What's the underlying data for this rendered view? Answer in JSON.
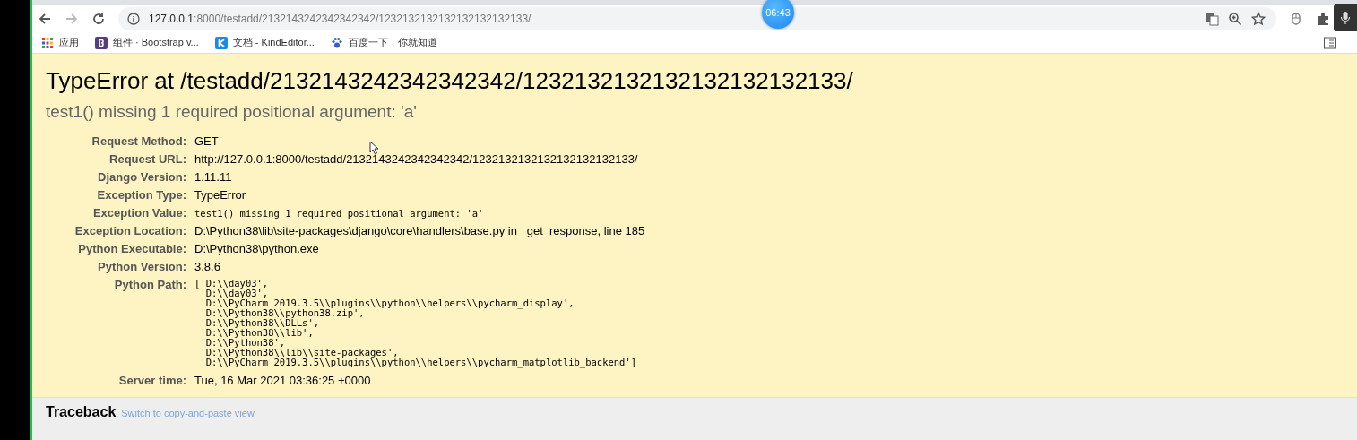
{
  "browser": {
    "url_host": "127.0.0.1",
    "url_rest": ":8000/testadd/2132143242342342342/1232132132132132132132133/",
    "bookmarks": [
      {
        "label": "应用"
      },
      {
        "label": "组件 · Bootstrap v..."
      },
      {
        "label": "文档 - KindEditor..."
      },
      {
        "label": "百度一下，你就知道"
      }
    ],
    "clock": "06:43"
  },
  "error": {
    "title": "TypeError at /testadd/2132143242342342342/1232132132132132132132133/",
    "message": "test1() missing 1 required positional argument: 'a'"
  },
  "meta": [
    {
      "label": "Request Method:",
      "kind": "text",
      "value": "GET"
    },
    {
      "label": "Request URL:",
      "kind": "text",
      "value": "http://127.0.0.1:8000/testadd/2132143242342342342/1232132132132132132132133/"
    },
    {
      "label": "Django Version:",
      "kind": "text",
      "value": "1.11.11"
    },
    {
      "label": "Exception Type:",
      "kind": "text",
      "value": "TypeError"
    },
    {
      "label": "Exception Value:",
      "kind": "code",
      "value": "test1() missing 1 required positional argument: 'a'"
    },
    {
      "label": "Exception Location:",
      "kind": "text",
      "value": "D:\\Python38\\lib\\site-packages\\django\\core\\handlers\\base.py in _get_response, line 185"
    },
    {
      "label": "Python Executable:",
      "kind": "text",
      "value": "D:\\Python38\\python.exe"
    },
    {
      "label": "Python Version:",
      "kind": "text",
      "value": "3.8.6"
    },
    {
      "label": "Python Path:",
      "kind": "list",
      "lines": [
        "['D:\\\\day03',",
        " 'D:\\\\day03',",
        " 'D:\\\\PyCharm 2019.3.5\\\\plugins\\\\python\\\\helpers\\\\pycharm_display',",
        " 'D:\\\\Python38\\\\python38.zip',",
        " 'D:\\\\Python38\\\\DLLs',",
        " 'D:\\\\Python38\\\\lib',",
        " 'D:\\\\Python38',",
        " 'D:\\\\Python38\\\\lib\\\\site-packages',",
        " 'D:\\\\PyCharm 2019.3.5\\\\plugins\\\\python\\\\helpers\\\\pycharm_matplotlib_backend']"
      ]
    },
    {
      "label": "Server time:",
      "kind": "text",
      "value": "Tue, 16 Mar 2021 03:36:25 +0000"
    }
  ],
  "traceback": {
    "heading": "Traceback",
    "link": "Switch to copy-and-paste view"
  }
}
